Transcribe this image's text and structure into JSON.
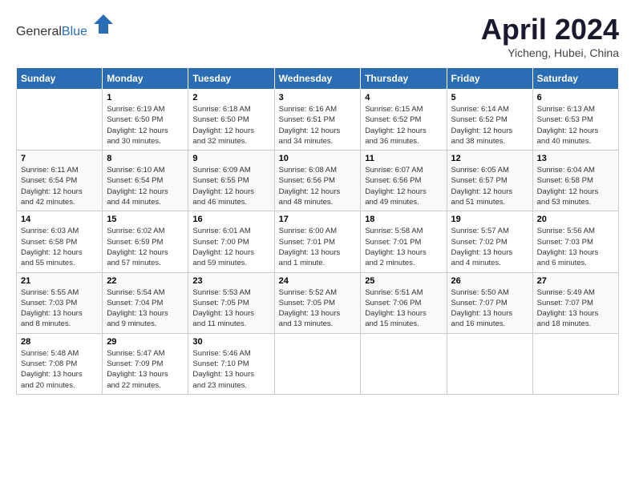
{
  "header": {
    "logo_general": "General",
    "logo_blue": "Blue",
    "month_title": "April 2024",
    "subtitle": "Yicheng, Hubei, China"
  },
  "calendar": {
    "days_of_week": [
      "Sunday",
      "Monday",
      "Tuesday",
      "Wednesday",
      "Thursday",
      "Friday",
      "Saturday"
    ],
    "weeks": [
      [
        {
          "day": "",
          "info": ""
        },
        {
          "day": "1",
          "info": "Sunrise: 6:19 AM\nSunset: 6:50 PM\nDaylight: 12 hours\nand 30 minutes."
        },
        {
          "day": "2",
          "info": "Sunrise: 6:18 AM\nSunset: 6:50 PM\nDaylight: 12 hours\nand 32 minutes."
        },
        {
          "day": "3",
          "info": "Sunrise: 6:16 AM\nSunset: 6:51 PM\nDaylight: 12 hours\nand 34 minutes."
        },
        {
          "day": "4",
          "info": "Sunrise: 6:15 AM\nSunset: 6:52 PM\nDaylight: 12 hours\nand 36 minutes."
        },
        {
          "day": "5",
          "info": "Sunrise: 6:14 AM\nSunset: 6:52 PM\nDaylight: 12 hours\nand 38 minutes."
        },
        {
          "day": "6",
          "info": "Sunrise: 6:13 AM\nSunset: 6:53 PM\nDaylight: 12 hours\nand 40 minutes."
        }
      ],
      [
        {
          "day": "7",
          "info": "Sunrise: 6:11 AM\nSunset: 6:54 PM\nDaylight: 12 hours\nand 42 minutes."
        },
        {
          "day": "8",
          "info": "Sunrise: 6:10 AM\nSunset: 6:54 PM\nDaylight: 12 hours\nand 44 minutes."
        },
        {
          "day": "9",
          "info": "Sunrise: 6:09 AM\nSunset: 6:55 PM\nDaylight: 12 hours\nand 46 minutes."
        },
        {
          "day": "10",
          "info": "Sunrise: 6:08 AM\nSunset: 6:56 PM\nDaylight: 12 hours\nand 48 minutes."
        },
        {
          "day": "11",
          "info": "Sunrise: 6:07 AM\nSunset: 6:56 PM\nDaylight: 12 hours\nand 49 minutes."
        },
        {
          "day": "12",
          "info": "Sunrise: 6:05 AM\nSunset: 6:57 PM\nDaylight: 12 hours\nand 51 minutes."
        },
        {
          "day": "13",
          "info": "Sunrise: 6:04 AM\nSunset: 6:58 PM\nDaylight: 12 hours\nand 53 minutes."
        }
      ],
      [
        {
          "day": "14",
          "info": "Sunrise: 6:03 AM\nSunset: 6:58 PM\nDaylight: 12 hours\nand 55 minutes."
        },
        {
          "day": "15",
          "info": "Sunrise: 6:02 AM\nSunset: 6:59 PM\nDaylight: 12 hours\nand 57 minutes."
        },
        {
          "day": "16",
          "info": "Sunrise: 6:01 AM\nSunset: 7:00 PM\nDaylight: 12 hours\nand 59 minutes."
        },
        {
          "day": "17",
          "info": "Sunrise: 6:00 AM\nSunset: 7:01 PM\nDaylight: 13 hours\nand 1 minute."
        },
        {
          "day": "18",
          "info": "Sunrise: 5:58 AM\nSunset: 7:01 PM\nDaylight: 13 hours\nand 2 minutes."
        },
        {
          "day": "19",
          "info": "Sunrise: 5:57 AM\nSunset: 7:02 PM\nDaylight: 13 hours\nand 4 minutes."
        },
        {
          "day": "20",
          "info": "Sunrise: 5:56 AM\nSunset: 7:03 PM\nDaylight: 13 hours\nand 6 minutes."
        }
      ],
      [
        {
          "day": "21",
          "info": "Sunrise: 5:55 AM\nSunset: 7:03 PM\nDaylight: 13 hours\nand 8 minutes."
        },
        {
          "day": "22",
          "info": "Sunrise: 5:54 AM\nSunset: 7:04 PM\nDaylight: 13 hours\nand 9 minutes."
        },
        {
          "day": "23",
          "info": "Sunrise: 5:53 AM\nSunset: 7:05 PM\nDaylight: 13 hours\nand 11 minutes."
        },
        {
          "day": "24",
          "info": "Sunrise: 5:52 AM\nSunset: 7:05 PM\nDaylight: 13 hours\nand 13 minutes."
        },
        {
          "day": "25",
          "info": "Sunrise: 5:51 AM\nSunset: 7:06 PM\nDaylight: 13 hours\nand 15 minutes."
        },
        {
          "day": "26",
          "info": "Sunrise: 5:50 AM\nSunset: 7:07 PM\nDaylight: 13 hours\nand 16 minutes."
        },
        {
          "day": "27",
          "info": "Sunrise: 5:49 AM\nSunset: 7:07 PM\nDaylight: 13 hours\nand 18 minutes."
        }
      ],
      [
        {
          "day": "28",
          "info": "Sunrise: 5:48 AM\nSunset: 7:08 PM\nDaylight: 13 hours\nand 20 minutes."
        },
        {
          "day": "29",
          "info": "Sunrise: 5:47 AM\nSunset: 7:09 PM\nDaylight: 13 hours\nand 22 minutes."
        },
        {
          "day": "30",
          "info": "Sunrise: 5:46 AM\nSunset: 7:10 PM\nDaylight: 13 hours\nand 23 minutes."
        },
        {
          "day": "",
          "info": ""
        },
        {
          "day": "",
          "info": ""
        },
        {
          "day": "",
          "info": ""
        },
        {
          "day": "",
          "info": ""
        }
      ]
    ]
  }
}
